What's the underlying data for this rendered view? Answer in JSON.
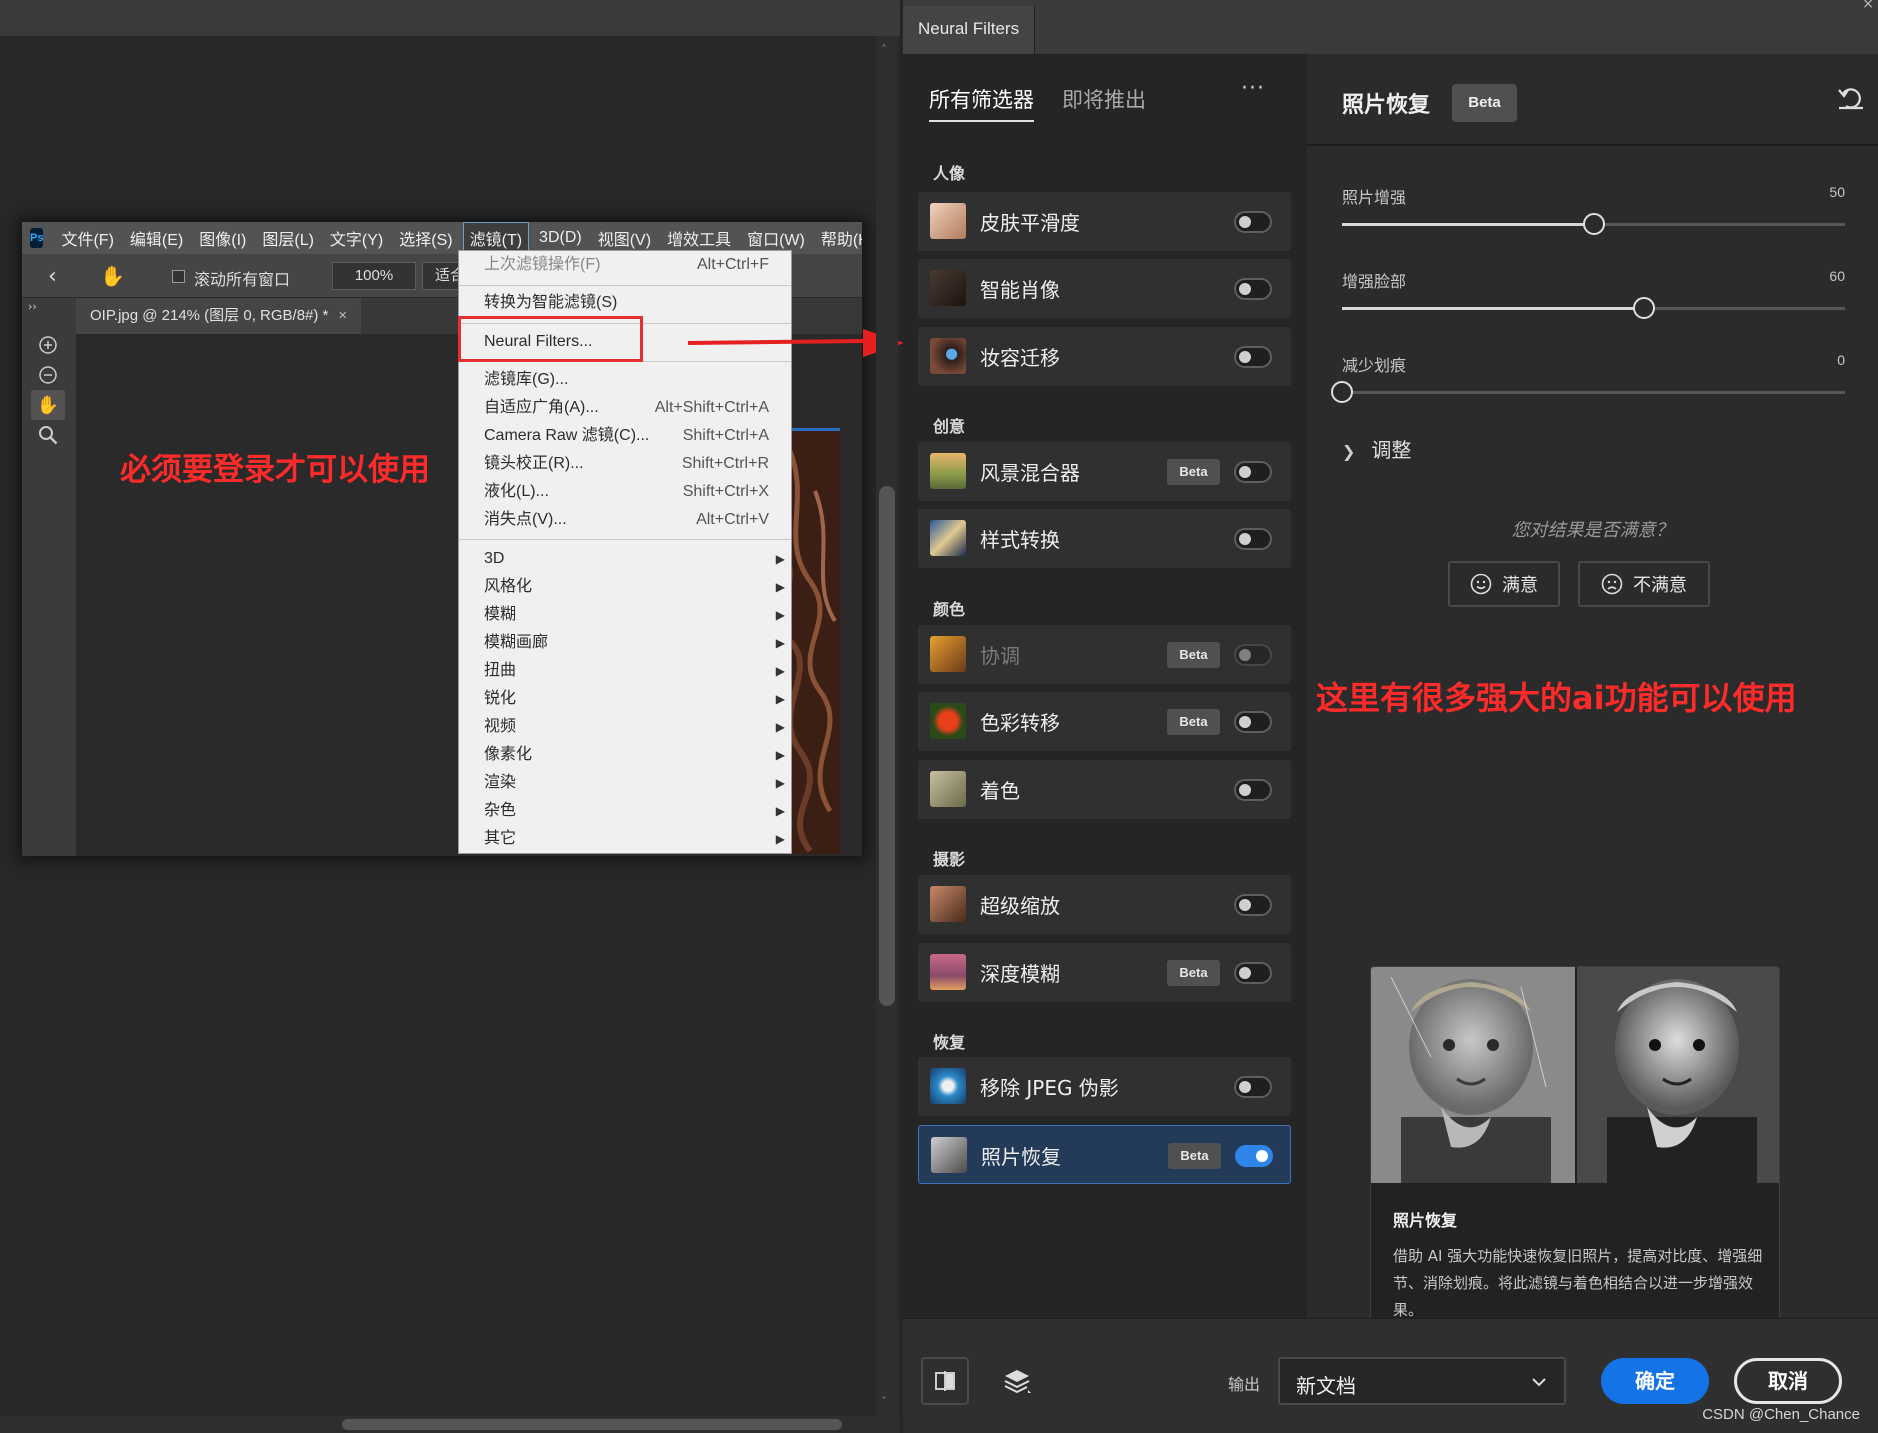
{
  "photoshop": {
    "menubar": [
      "文件(F)",
      "编辑(E)",
      "图像(I)",
      "图层(L)",
      "文字(Y)",
      "选择(S)",
      "滤镜(T)",
      "3D(D)",
      "视图(V)",
      "增效工具",
      "窗口(W)",
      "帮助(H"
    ],
    "logo": "Ps",
    "options": {
      "scroll_all_label": "滚动所有窗口",
      "zoom": "100%",
      "fit": "适合"
    },
    "doc_tab": {
      "title": "OIP.jpg @ 214% (图层 0, RGB/8#) *",
      "close": "×"
    },
    "toolbar_collapse": "››",
    "filter_menu": {
      "last_filter": {
        "label": "上次滤镜操作(F)",
        "shortcut": "Alt+Ctrl+F"
      },
      "smart": {
        "label": "转换为智能滤镜(S)"
      },
      "neural": {
        "label": "Neural Filters..."
      },
      "gallery": {
        "label": "滤镜库(G)..."
      },
      "adaptive": {
        "label": "自适应广角(A)...",
        "shortcut": "Alt+Shift+Ctrl+A"
      },
      "camera_raw": {
        "label": "Camera Raw 滤镜(C)...",
        "shortcut": "Shift+Ctrl+A"
      },
      "lens": {
        "label": "镜头校正(R)...",
        "shortcut": "Shift+Ctrl+R"
      },
      "liquify": {
        "label": "液化(L)...",
        "shortcut": "Shift+Ctrl+X"
      },
      "vanishing": {
        "label": "消失点(V)...",
        "shortcut": "Alt+Ctrl+V"
      },
      "submenus": [
        "3D",
        "风格化",
        "模糊",
        "模糊画廊",
        "扭曲",
        "锐化",
        "视频",
        "像素化",
        "渲染",
        "杂色",
        "其它"
      ]
    }
  },
  "annotations": {
    "left": "必须要登录才可以使用",
    "right": "这里有很多强大的ai功能可以使用"
  },
  "neural_filters": {
    "title": "Neural Filters",
    "close": "×",
    "tabs": {
      "all": "所有筛选器",
      "coming": "即将推出"
    },
    "more": "···",
    "sections": {
      "portrait": "人像",
      "creative": "创意",
      "color": "颜色",
      "photo": "摄影",
      "restore": "恢复"
    },
    "beta": "Beta",
    "filters": {
      "skin": {
        "label": "皮肤平滑度",
        "on": false
      },
      "smart_portrait": {
        "label": "智能肖像",
        "on": false
      },
      "makeup": {
        "label": "妆容迁移",
        "on": false
      },
      "landscape": {
        "label": "风景混合器",
        "on": false
      },
      "style": {
        "label": "样式转换",
        "on": false
      },
      "harmonize": {
        "label": "协调",
        "on": false
      },
      "color_transfer": {
        "label": "色彩转移",
        "on": false
      },
      "colorize": {
        "label": "着色",
        "on": false
      },
      "superzoom": {
        "label": "超级缩放",
        "on": false
      },
      "depth_blur": {
        "label": "深度模糊",
        "on": false
      },
      "jpeg": {
        "label": "移除 JPEG 伪影",
        "on": false
      },
      "photo_restore": {
        "label": "照片恢复",
        "on": true
      }
    },
    "detail": {
      "title": "照片恢复",
      "beta": "Beta",
      "sliders": [
        {
          "label": "照片增强",
          "value": 50
        },
        {
          "label": "增强脸部",
          "value": 60
        },
        {
          "label": "减少划痕",
          "value": 0
        }
      ],
      "adjust": "调整",
      "question": "您对结果是否满意？",
      "satisfied": "满意",
      "unsatisfied": "不满意",
      "preview_title": "照片恢复",
      "preview_desc": "借助 AI 强大功能快速恢复旧照片，提高对比度、增强细节、消除划痕。将此滤镜与着色相结合以进一步增强效果。"
    },
    "footer": {
      "output_label": "输出",
      "output_value": "新文档",
      "ok": "确定",
      "cancel": "取消"
    }
  },
  "watermark": "CSDN @Chen_Chance",
  "colors": {
    "accent": "#1473e6",
    "annotation": "#ff2a2a",
    "highlight_box": "#e53030"
  }
}
